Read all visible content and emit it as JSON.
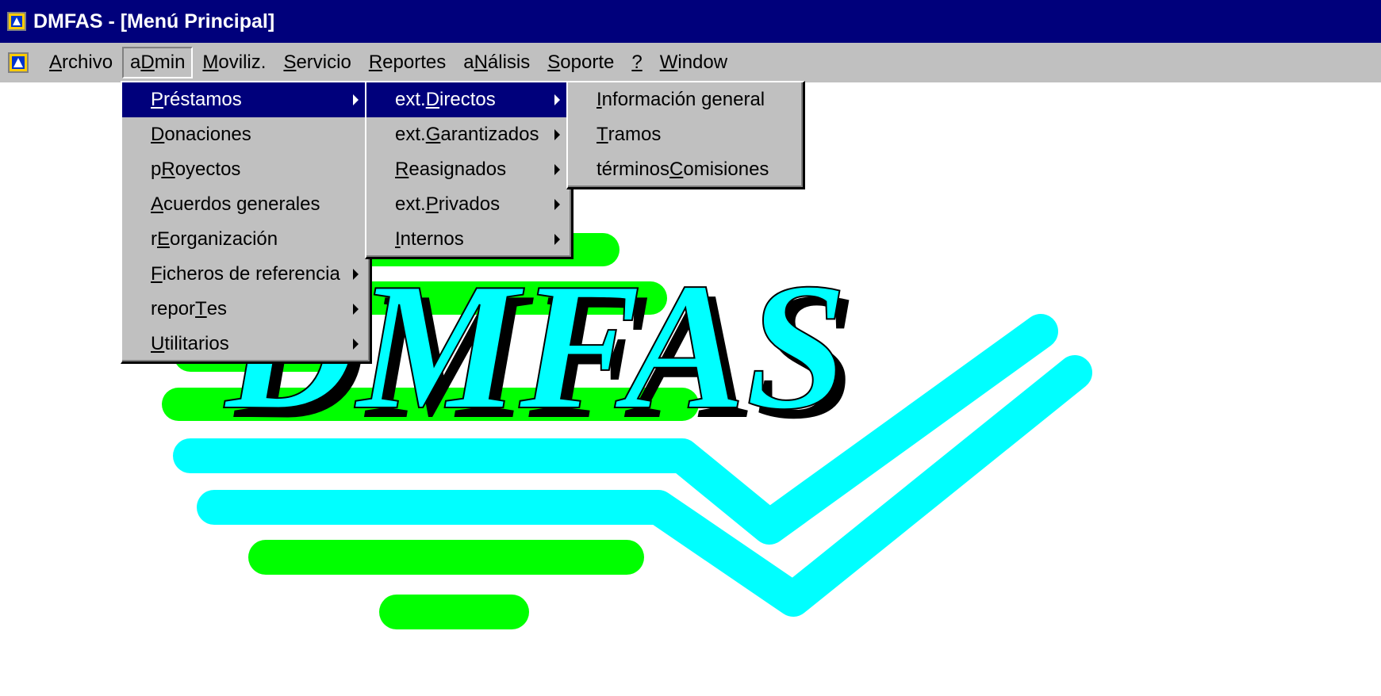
{
  "window": {
    "title": "DMFAS - [Menú Principal]"
  },
  "menubar": {
    "items": [
      {
        "label": "Archivo",
        "access": "A",
        "pre": "",
        "post": "rchivo"
      },
      {
        "label": "aDmin",
        "pre": "a",
        "access": "D",
        "post": "min"
      },
      {
        "label": "Moviliz.",
        "pre": "",
        "access": "M",
        "post": "oviliz."
      },
      {
        "label": "Servicio",
        "pre": "",
        "access": "S",
        "post": "ervicio"
      },
      {
        "label": "Reportes",
        "pre": "",
        "access": "R",
        "post": "eportes"
      },
      {
        "label": "aNálisis",
        "pre": "a",
        "access": "N",
        "post": "álisis"
      },
      {
        "label": "Soporte",
        "pre": "",
        "access": "S",
        "post": "oporte"
      },
      {
        "label": "?",
        "pre": "",
        "access": "?",
        "post": ""
      },
      {
        "label": "Window",
        "pre": "",
        "access": "W",
        "post": "indow"
      }
    ]
  },
  "admin_menu": {
    "items": [
      {
        "pre": "",
        "access": "P",
        "post": "réstamos"
      },
      {
        "pre": "",
        "access": "D",
        "post": "onaciones"
      },
      {
        "pre": "p",
        "access": "R",
        "post": "oyectos"
      },
      {
        "pre": "",
        "access": "A",
        "post": "cuerdos generales"
      },
      {
        "pre": "r",
        "access": "E",
        "post": "organización"
      },
      {
        "pre": "",
        "access": "F",
        "post": "icheros de referencia"
      },
      {
        "pre": "repor",
        "access": "T",
        "post": "es"
      },
      {
        "pre": "",
        "access": "U",
        "post": "tilitarios"
      }
    ]
  },
  "prestamos_menu": {
    "items": [
      {
        "pre": "ext. ",
        "access": "D",
        "post": "irectos"
      },
      {
        "pre": "ext. ",
        "access": "G",
        "post": "arantizados"
      },
      {
        "pre": "",
        "access": "R",
        "post": "easignados"
      },
      {
        "pre": "ext. ",
        "access": "P",
        "post": "rivados"
      },
      {
        "pre": "",
        "access": "I",
        "post": "nternos"
      }
    ]
  },
  "directos_menu": {
    "items": [
      {
        "pre": "",
        "access": "I",
        "post": "nformación general"
      },
      {
        "pre": "",
        "access": "T",
        "post": "ramos"
      },
      {
        "pre": "términos ",
        "access": "C",
        "post": "omisiones"
      }
    ]
  },
  "logo": {
    "text": "DMFAS",
    "colors": {
      "green": "#00ff00",
      "cyan": "#00ffff",
      "shadow": "#000000"
    }
  },
  "colors": {
    "titlebar": "#00007b",
    "menu_bg": "#c0c0c0",
    "highlight": "#00007b"
  }
}
